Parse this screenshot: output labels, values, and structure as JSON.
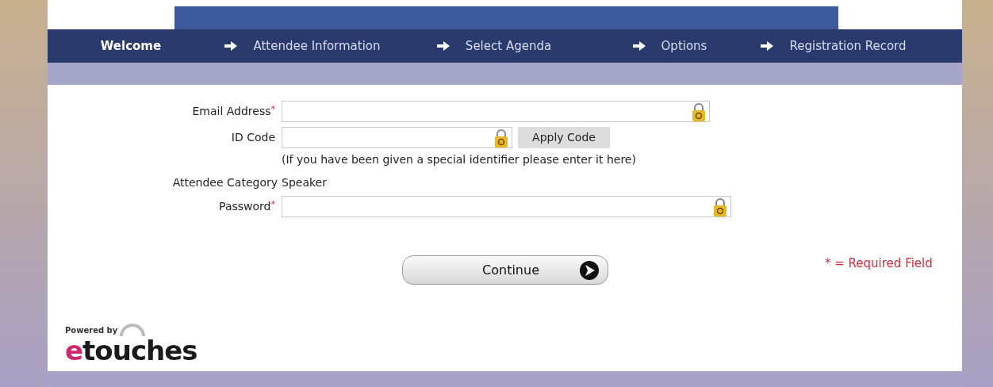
{
  "steps": [
    {
      "label": "Welcome",
      "selected": true
    },
    {
      "label": "Attendee Information",
      "selected": false
    },
    {
      "label": "Select Agenda",
      "selected": false
    },
    {
      "label": "Options",
      "selected": false
    },
    {
      "label": "Registration Record",
      "selected": false
    }
  ],
  "form": {
    "email": {
      "label": "Email Address",
      "required": true
    },
    "id_code": {
      "label": "ID Code",
      "button": "Apply Code",
      "hint": "(If you have been given a special identifier please enter it here)"
    },
    "attendee_category": {
      "label": "Attendee Category",
      "value": "Speaker"
    },
    "password": {
      "label": "Password",
      "required": true
    }
  },
  "required_mark": "*",
  "continue_button": "Continue",
  "required_note": "* = Required Field",
  "footer": {
    "powered_by": "Powered by",
    "brand_first": "e",
    "brand_rest": "touches"
  }
}
